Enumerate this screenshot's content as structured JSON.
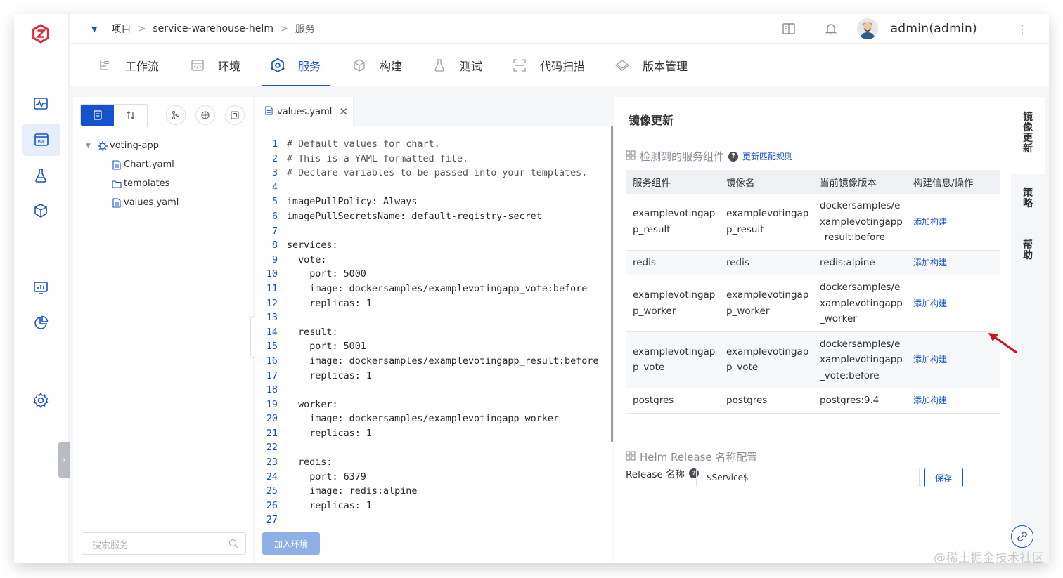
{
  "breadcrumb": {
    "project": "项目",
    "sep1": ">",
    "name": "service-warehouse-helm",
    "sep2": ">",
    "current": "服务"
  },
  "user": {
    "name": "admin(admin)"
  },
  "tabs": [
    {
      "label": "工作流",
      "icon": "workflow-icon"
    },
    {
      "label": "环境",
      "icon": "environment-icon"
    },
    {
      "label": "服务",
      "icon": "service-icon",
      "active": true
    },
    {
      "label": "构建",
      "icon": "build-icon"
    },
    {
      "label": "测试",
      "icon": "test-icon"
    },
    {
      "label": "代码扫描",
      "icon": "scan-icon"
    },
    {
      "label": "版本管理",
      "icon": "version-icon"
    }
  ],
  "tree": {
    "root": "voting-app",
    "files": [
      "Chart.yaml",
      "templates",
      "values.yaml"
    ],
    "search_placeholder": "搜索服务"
  },
  "editor": {
    "tab": "values.yaml",
    "add_env": "加入环境",
    "lines": [
      {
        "n": "1",
        "t": "# Default values for chart."
      },
      {
        "n": "2",
        "t": "# This is a YAML-formatted file."
      },
      {
        "n": "3",
        "t": "# Declare variables to be passed into your templates."
      },
      {
        "n": "4",
        "t": ""
      },
      {
        "n": "5",
        "t": "imagePullPolicy: Always"
      },
      {
        "n": "6",
        "t": "imagePullSecretsName: default-registry-secret"
      },
      {
        "n": "7",
        "t": ""
      },
      {
        "n": "8",
        "t": "services:"
      },
      {
        "n": "9",
        "t": "  vote:"
      },
      {
        "n": "10",
        "t": "    port: 5000"
      },
      {
        "n": "11",
        "t": "    image: dockersamples/examplevotingapp_vote:before"
      },
      {
        "n": "12",
        "t": "    replicas: 1"
      },
      {
        "n": "13",
        "t": ""
      },
      {
        "n": "14",
        "t": "  result:"
      },
      {
        "n": "15",
        "t": "    port: 5001"
      },
      {
        "n": "16",
        "t": "    image: dockersamples/examplevotingapp_result:before"
      },
      {
        "n": "17",
        "t": "    replicas: 1"
      },
      {
        "n": "18",
        "t": ""
      },
      {
        "n": "19",
        "t": "  worker:"
      },
      {
        "n": "20",
        "t": "    image: dockersamples/examplevotingapp_worker"
      },
      {
        "n": "21",
        "t": "    replicas: 1"
      },
      {
        "n": "22",
        "t": ""
      },
      {
        "n": "23",
        "t": "  redis:"
      },
      {
        "n": "24",
        "t": "    port: 6379"
      },
      {
        "n": "25",
        "t": "    image: redis:alpine"
      },
      {
        "n": "26",
        "t": "    replicas: 1"
      },
      {
        "n": "27",
        "t": ""
      }
    ]
  },
  "panel": {
    "title": "镜像更新",
    "detected_label": "检测到的服务组件",
    "rule_link": "更新匹配规则",
    "columns": [
      "服务组件",
      "镜像名",
      "当前镜像版本",
      "构建信息/操作"
    ],
    "rows": [
      {
        "component": "examplevotingapp_result",
        "image": "examplevotingapp_result",
        "version": "dockersamples/examplevotingapp_result:before",
        "action": "添加构建"
      },
      {
        "component": "redis",
        "image": "redis",
        "version": "redis:alpine",
        "action": "添加构建"
      },
      {
        "component": "examplevotingapp_worker",
        "image": "examplevotingapp_worker",
        "version": "dockersamples/examplevotingapp_worker",
        "action": "添加构建"
      },
      {
        "component": "examplevotingapp_vote",
        "image": "examplevotingapp_vote",
        "version": "dockersamples/examplevotingapp_vote:before",
        "action": "添加构建"
      },
      {
        "component": "postgres",
        "image": "postgres",
        "version": "postgres:9.4",
        "action": "添加构建"
      }
    ],
    "helm_section": "Helm Release 名称配置",
    "release_label": "Release 名称",
    "release_value": "$Service$",
    "save": "保存"
  },
  "side_tabs": [
    "镜像更新",
    "策略",
    "帮助"
  ],
  "watermark": "@稀土掘金技术社区",
  "colors": {
    "accent": "#1553cc",
    "logo": "#e0263a",
    "arrow": "#d0101b"
  }
}
